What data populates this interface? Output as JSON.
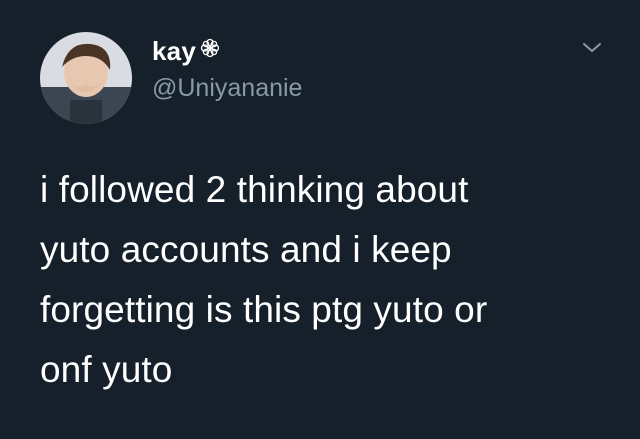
{
  "tweet": {
    "author": {
      "display_name": "kay",
      "handle": "@Uniyananie",
      "name_emoji_icon": "flower-icon",
      "avatar_icon": "profile-photo"
    },
    "menu_icon": "chevron-down-icon",
    "text": "i followed 2 thinking about\nyuto accounts and i keep\nforgetting is this ptg yuto or\nonf yuto"
  },
  "colors": {
    "background": "#15202b",
    "primary_text": "#ffffff",
    "secondary_text": "#8899a6"
  }
}
